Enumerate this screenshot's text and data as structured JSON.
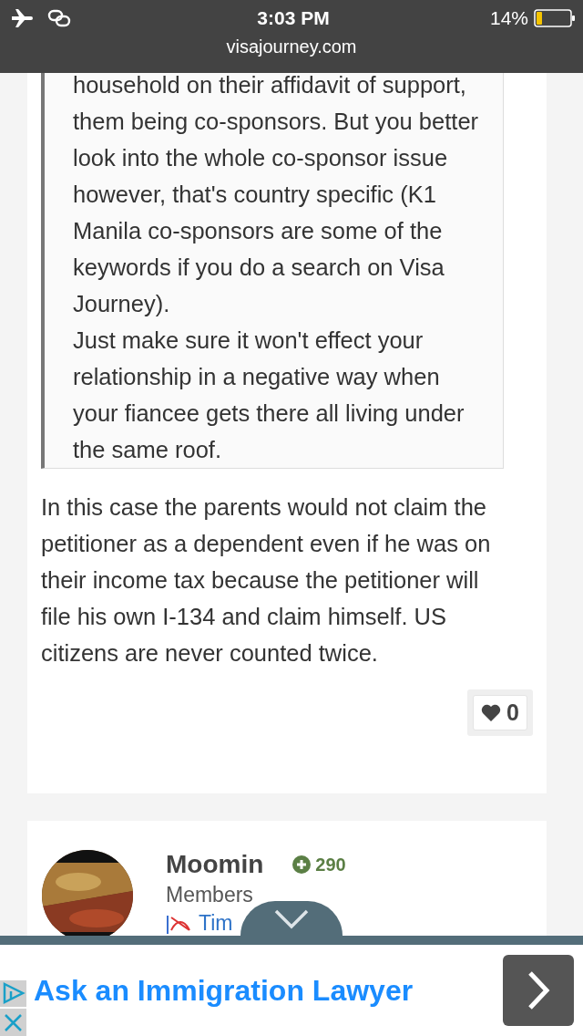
{
  "status_bar": {
    "time": "3:03 PM",
    "battery": "14%",
    "url": "visajourney.com"
  },
  "quote": {
    "paragraphs": [
      "household on their affidavit of support, them being co-sponsors. But you better look into the whole co-sponsor issue however, that's country specific (K1 Manila co-sponsors are some of the keywords if you do a search on Visa Journey).",
      "Just make sure it won't effect your relationship in a negative way when your fiancee gets there all living under the same roof."
    ]
  },
  "post_text": "In this case the parents would not claim the petitioner as a dependent even if he was on their income tax because the petitioner will file his own I-134 and claim himself. US citizens are never counted twice.",
  "like_count": "0",
  "next_post": {
    "author": "Moomin",
    "reputation": "290",
    "group": "Members",
    "flag_label": "Tim"
  },
  "ad": {
    "text": "Ask an Immigration Lawyer"
  }
}
